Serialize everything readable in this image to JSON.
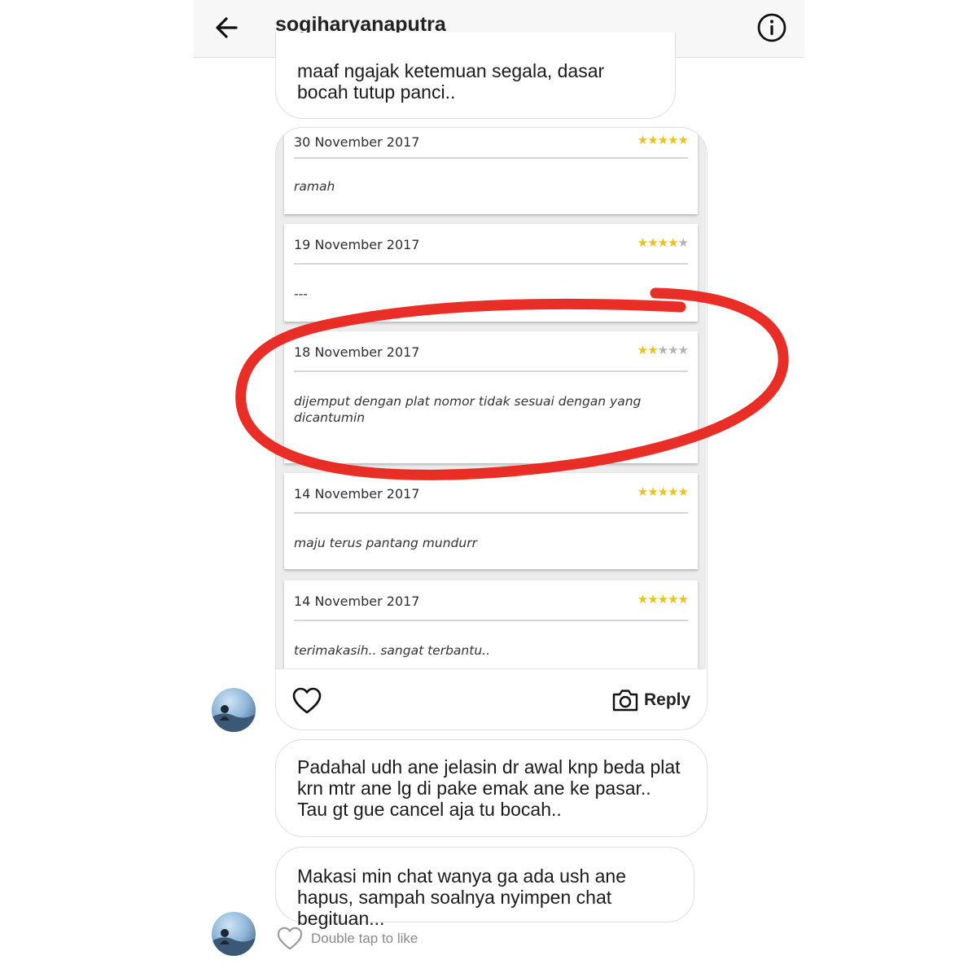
{
  "header": {
    "username": "sogiharyanaputra",
    "back_icon": "arrow-left-icon",
    "info_icon": "info-circle-icon"
  },
  "messages": {
    "top_bubble_text": "maaf ngajak ketemuan segala, dasar bocah tutup panci..",
    "shared_image": {
      "reviews": [
        {
          "date": "30 November 2017",
          "rating": 5,
          "text": "ramah"
        },
        {
          "date": "19 November 2017",
          "rating": 4,
          "text": "---"
        },
        {
          "date": "18 November 2017",
          "rating": 2,
          "text": "dijemput dengan plat nomor tidak sesuai dengan yang dicantumin"
        },
        {
          "date": "14 November 2017",
          "rating": 5,
          "text": "maju terus pantang mundurr"
        },
        {
          "date": "14 November 2017",
          "rating": 5,
          "text": "terimakasih..  sangat terbantu.."
        }
      ],
      "reply_label": "Reply",
      "like_icon": "heart-outline-icon",
      "camera_icon": "camera-icon"
    },
    "bubble_2_text": "Padahal udh ane jelasin dr awal knp beda plat krn mtr ane lg di pake emak ane ke pasar.. Tau gt gue cancel aja tu bocah..",
    "bubble_3_text": "Makasi min chat wanya ga ada ush ane hapus, sampah soalnya nyimpen chat begituan...",
    "double_tap_label": "Double tap to like"
  },
  "colors": {
    "star_on": "#e8c21e",
    "star_off": "#b4b4b4",
    "annotation_red": "#e8231c"
  }
}
